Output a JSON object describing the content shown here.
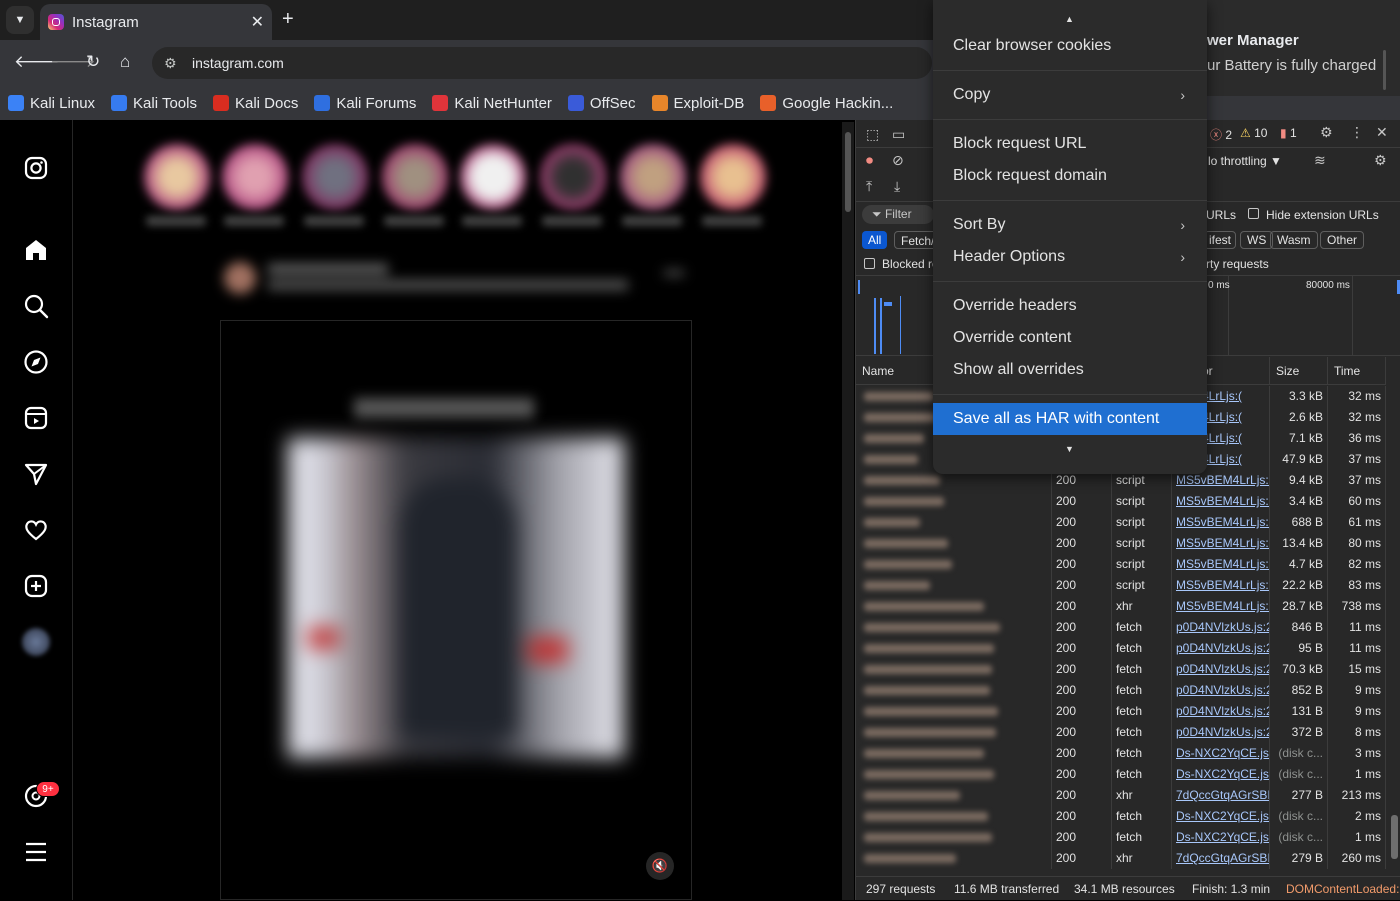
{
  "browser": {
    "tab_title": "Instagram",
    "url": "instagram.com",
    "tab_list_icon": "chevron-down-icon",
    "close_glyph": "✕",
    "new_tab_glyph": "+",
    "bookmarks": [
      {
        "label": "Kali Linux",
        "color": "#3b82f6"
      },
      {
        "label": "Kali Tools",
        "color": "#367bf0"
      },
      {
        "label": "Kali Docs",
        "color": "#d92d20"
      },
      {
        "label": "Kali Forums",
        "color": "#2f6fe0"
      },
      {
        "label": "Kali NetHunter",
        "color": "#e0343a"
      },
      {
        "label": "OffSec",
        "color": "#3a5bd9"
      },
      {
        "label": "Exploit-DB",
        "color": "#e8862a"
      },
      {
        "label": "Google Hackin...",
        "color": "#e8602a"
      }
    ]
  },
  "notification": {
    "title": "wer Manager",
    "body": "ur Battery is fully charged"
  },
  "instagram": {
    "notification_badge": "9+"
  },
  "context_menu": {
    "items": [
      {
        "label": "Clear browser cookies"
      },
      {
        "label": "Copy"
      },
      {
        "label": "Block request URL"
      },
      {
        "label": "Block request domain"
      },
      {
        "label": "Sort By"
      },
      {
        "label": "Header Options"
      },
      {
        "label": "Override headers"
      },
      {
        "label": "Override content"
      },
      {
        "label": "Show all overrides"
      },
      {
        "label": "Save all as HAR with content"
      }
    ]
  },
  "devtools": {
    "errors": "2",
    "warnings": "10",
    "issues": "1",
    "throttling": "lo throttling",
    "filter_placeholder": "Filter",
    "hide_data_urls_tail": "URLs",
    "hide_extension_urls": "Hide extension URLs",
    "type_filters": [
      "All",
      "Fetch/",
      "ifest",
      "WS",
      "Wasm",
      "Other"
    ],
    "blocked_requests": "Blocked re",
    "third_party": "rty requests",
    "timeline_labels": [
      "0 ms",
      "80000 ms"
    ],
    "columns": {
      "name": "Name",
      "initiator": "or",
      "size": "Size",
      "time": "Time"
    },
    "rows": [
      {
        "status": "",
        "type": "",
        "initiator": "BEM4LrLjs:(",
        "size": "3.3 kB",
        "time": "32 ms"
      },
      {
        "status": "",
        "type": "",
        "initiator": "BEM4LrLjs:(",
        "size": "2.6 kB",
        "time": "32 ms"
      },
      {
        "status": "",
        "type": "",
        "initiator": "BEM4LrLjs:(",
        "size": "7.1 kB",
        "time": "36 ms"
      },
      {
        "status": "",
        "type": "",
        "initiator": "BEM4LrLjs:(",
        "size": "47.9 kB",
        "time": "37 ms"
      },
      {
        "status": "200",
        "type": "script",
        "initiator": "MS5vBEM4LrLjs:(",
        "size": "9.4 kB",
        "time": "37 ms"
      },
      {
        "status": "200",
        "type": "script",
        "initiator": "MS5vBEM4LrLjs:(",
        "size": "3.4 kB",
        "time": "60 ms"
      },
      {
        "status": "200",
        "type": "script",
        "initiator": "MS5vBEM4LrLjs:(",
        "size": "688 B",
        "time": "61 ms"
      },
      {
        "status": "200",
        "type": "script",
        "initiator": "MS5vBEM4LrLjs:(",
        "size": "13.4 kB",
        "time": "80 ms"
      },
      {
        "status": "200",
        "type": "script",
        "initiator": "MS5vBEM4LrLjs:(",
        "size": "4.7 kB",
        "time": "82 ms"
      },
      {
        "status": "200",
        "type": "script",
        "initiator": "MS5vBEM4LrLjs:(",
        "size": "22.2 kB",
        "time": "83 ms"
      },
      {
        "status": "200",
        "type": "xhr",
        "initiator": "MS5vBEM4LrLjs:2",
        "size": "28.7 kB",
        "time": "738 ms"
      },
      {
        "status": "200",
        "type": "fetch",
        "initiator": "p0D4NVlzkUs.js:2",
        "size": "846 B",
        "time": "11 ms"
      },
      {
        "status": "200",
        "type": "fetch",
        "initiator": "p0D4NVlzkUs.js:2",
        "size": "95 B",
        "time": "11 ms"
      },
      {
        "status": "200",
        "type": "fetch",
        "initiator": "p0D4NVlzkUs.js:2",
        "size": "70.3 kB",
        "time": "15 ms"
      },
      {
        "status": "200",
        "type": "fetch",
        "initiator": "p0D4NVlzkUs.js:2",
        "size": "852 B",
        "time": "9 ms"
      },
      {
        "status": "200",
        "type": "fetch",
        "initiator": "p0D4NVlzkUs.js:2",
        "size": "131 B",
        "time": "9 ms"
      },
      {
        "status": "200",
        "type": "fetch",
        "initiator": "p0D4NVlzkUs.js:2",
        "size": "372 B",
        "time": "8 ms"
      },
      {
        "status": "200",
        "type": "fetch",
        "initiator": "Ds-NXC2YqCE.js:",
        "size": "(disk c...",
        "time": "3 ms"
      },
      {
        "status": "200",
        "type": "fetch",
        "initiator": "Ds-NXC2YqCE.js:",
        "size": "(disk c...",
        "time": "1 ms"
      },
      {
        "status": "200",
        "type": "xhr",
        "initiator": "7dQccGtqAGrSBI:",
        "size": "277 B",
        "time": "213 ms"
      },
      {
        "status": "200",
        "type": "fetch",
        "initiator": "Ds-NXC2YqCE.js:",
        "size": "(disk c...",
        "time": "2 ms"
      },
      {
        "status": "200",
        "type": "fetch",
        "initiator": "Ds-NXC2YqCE.js:",
        "size": "(disk c...",
        "time": "1 ms"
      },
      {
        "status": "200",
        "type": "xhr",
        "initiator": "7dQccGtqAGrSBI:",
        "size": "279 B",
        "time": "260 ms"
      }
    ],
    "status_bar": {
      "requests": "297 requests",
      "transferred": "11.6 MB transferred",
      "resources": "34.1 MB resources",
      "finish": "Finish: 1.3 min",
      "dcl": "DOMContentLoaded:"
    }
  }
}
